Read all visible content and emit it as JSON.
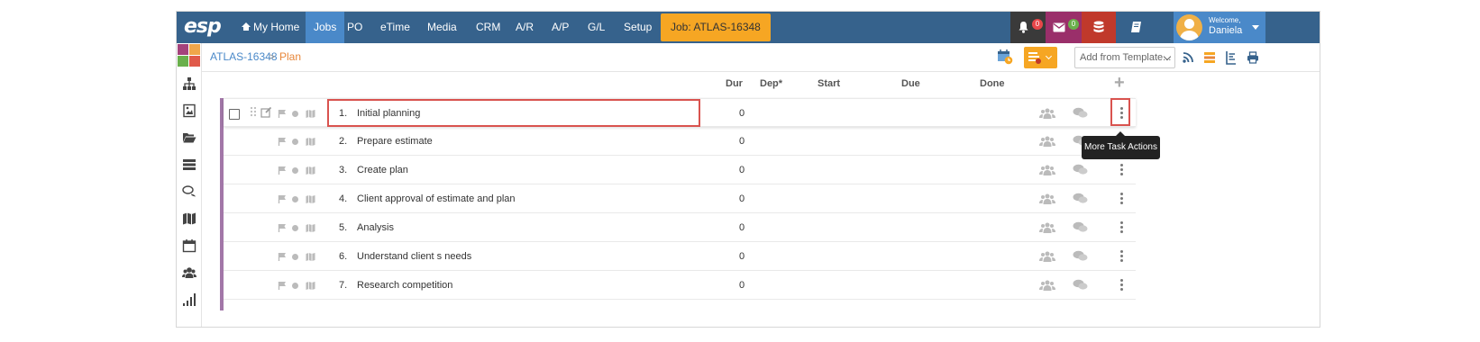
{
  "app": {
    "logo": "esp"
  },
  "nav": {
    "items": [
      {
        "label": "My Home"
      },
      {
        "label": "Jobs"
      },
      {
        "label": "PO"
      },
      {
        "label": "eTime"
      },
      {
        "label": "Media"
      },
      {
        "label": "CRM"
      },
      {
        "label": "A/R"
      },
      {
        "label": "A/P"
      },
      {
        "label": "G/L"
      },
      {
        "label": "Setup"
      }
    ],
    "active": "Jobs",
    "job_button": "Job: ATLAS-16348",
    "notifications_count": "0",
    "messages_count": "0",
    "welcome_label": "Welcome,",
    "user_name": "Daniela"
  },
  "breadcrumb": {
    "job": "ATLAS-16348",
    "separator": ">",
    "current": "Plan"
  },
  "toolbar": {
    "template_placeholder": "Add from Template..."
  },
  "columns": {
    "dur": "Dur",
    "dep": "Dep*",
    "start": "Start",
    "due": "Due",
    "done": "Done",
    "add": "+"
  },
  "tasks": [
    {
      "num": "1.",
      "name": "Initial planning",
      "dur": "0"
    },
    {
      "num": "2.",
      "name": "Prepare estimate",
      "dur": "0"
    },
    {
      "num": "3.",
      "name": "Create plan",
      "dur": "0"
    },
    {
      "num": "4.",
      "name": "Client approval of estimate and plan",
      "dur": "0"
    },
    {
      "num": "5.",
      "name": "Analysis",
      "dur": "0"
    },
    {
      "num": "6.",
      "name": "Understand client s needs",
      "dur": "0"
    },
    {
      "num": "7.",
      "name": "Research competition",
      "dur": "0"
    }
  ],
  "tooltip": "More Task Actions",
  "colors": {
    "topbar": "#36628c",
    "nav_active": "#4a89c9",
    "job_button": "#f6a623",
    "breadcrumb_link": "#4a89c9",
    "breadcrumb_current": "#e8873a",
    "highlight": "#d9534f",
    "row_rail": "#a277a8"
  }
}
